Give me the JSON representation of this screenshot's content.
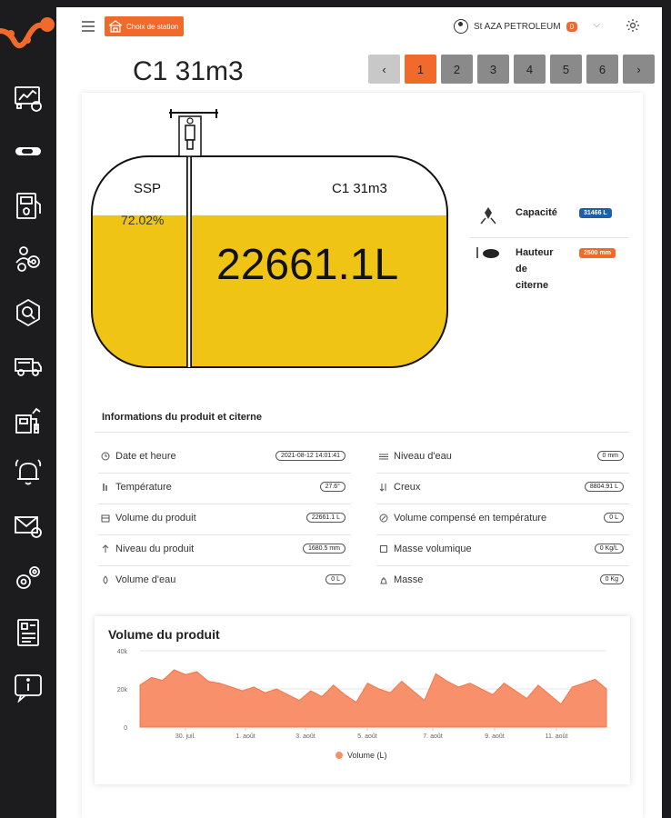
{
  "header": {
    "station_button_label": "Choix de station",
    "user_name": "St AZA PETROLEUM",
    "notification_count": "0"
  },
  "page": {
    "title": "C1 31m3",
    "pager": [
      "‹",
      "1",
      "2",
      "3",
      "4",
      "5",
      "6",
      "›"
    ],
    "active_page": "1"
  },
  "tank": {
    "product": "SSP",
    "name": "C1 31m3",
    "fill_percent_label": "72.02%",
    "fill_fraction": 0.7202,
    "volume_label": "22661.1L"
  },
  "tank_info": {
    "capacity_label": "Capacité",
    "capacity_value": "31466 L",
    "height_label_1": "Hauteur",
    "height_label_2": "de",
    "height_label_3": "citerne",
    "height_value": "2500 mm"
  },
  "product_info": {
    "title": "Informations du produit et citerne",
    "left": [
      {
        "label": "Date et heure",
        "value": "2021-08-12 14:01:41",
        "icon": "clock-icon"
      },
      {
        "label": "Température",
        "value": "27.6°",
        "icon": "thermometer-icon"
      },
      {
        "label": "Volume du produit",
        "value": "22661.1 L",
        "icon": "tank-icon"
      },
      {
        "label": "Niveau du produit",
        "value": "1680.5 mm",
        "icon": "level-icon"
      },
      {
        "label": "Volume d'eau",
        "value": "0 L",
        "icon": "drop-icon"
      }
    ],
    "right": [
      {
        "label": "Niveau d'eau",
        "value": "0 mm",
        "icon": "water-level-icon"
      },
      {
        "label": "Creux",
        "value": "8804.91 L",
        "icon": "sort-icon"
      },
      {
        "label": "Volume compensé en température",
        "value": "0 L",
        "icon": "compass-icon"
      },
      {
        "label": "Masse volumique",
        "value": "0 Kg/L",
        "icon": "square-icon"
      },
      {
        "label": "Masse",
        "value": "0 Kg",
        "icon": "weight-icon"
      }
    ]
  },
  "chart_data": {
    "type": "area",
    "title": "Volume du produit",
    "series": [
      {
        "name": "Volume (L)",
        "color": "#f8906b"
      }
    ],
    "ylim": [
      0,
      40000
    ],
    "yticks": [
      "40k",
      "20k",
      "0"
    ],
    "xticks": [
      "30. juil.",
      "1. août",
      "3. août",
      "5. août",
      "7. août",
      "9. août",
      "11. août"
    ],
    "x": [
      "29. juil.",
      "29. juil.",
      "30. juil.",
      "30. juil.",
      "30. juil.",
      "31. juil.",
      "31. juil.",
      "31. juil.",
      "1. août",
      "1. août",
      "1. août",
      "2. août",
      "2. août",
      "2. août",
      "3. août",
      "3. août",
      "3. août",
      "4. août",
      "4. août",
      "4. août",
      "5. août",
      "5. août",
      "5. août",
      "6. août",
      "6. août",
      "6. août",
      "7. août",
      "7. août",
      "7. août",
      "8. août",
      "8. août",
      "8. août",
      "9. août",
      "9. août",
      "9. août",
      "10. août",
      "10. août",
      "10. août",
      "11. août",
      "11. août",
      "11. août",
      "12. août"
    ],
    "y": [
      22000,
      26000,
      24500,
      30000,
      27500,
      29000,
      24000,
      23000,
      21000,
      19000,
      21000,
      18000,
      20000,
      17000,
      14000,
      19000,
      16000,
      22000,
      17000,
      13000,
      23000,
      20000,
      18000,
      24000,
      19000,
      14000,
      28000,
      24000,
      21000,
      23000,
      20000,
      17000,
      23000,
      19000,
      15000,
      22000,
      17000,
      12000,
      21000,
      23000,
      25000,
      20000
    ]
  }
}
